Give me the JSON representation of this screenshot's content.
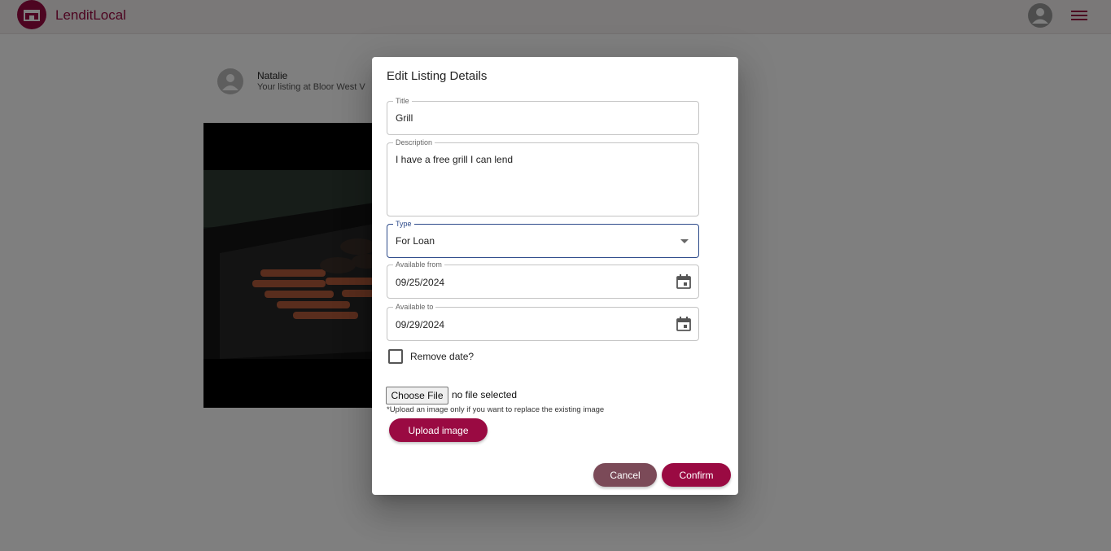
{
  "appbar": {
    "brand": "LenditLocal",
    "logo_icon": "storefront-icon",
    "avatar_icon": "account-circle-icon",
    "menu_icon": "hamburger-menu-icon",
    "accent_color": "#9a0a42"
  },
  "post": {
    "user_name": "Natalie",
    "subtitle": "Your listing at Bloor West V"
  },
  "dialog": {
    "title": "Edit Listing Details",
    "fields": {
      "title": {
        "label": "Title",
        "value": "Grill"
      },
      "description": {
        "label": "Description",
        "value": "I have a free grill I can lend"
      },
      "type": {
        "label": "Type",
        "value": "For Loan"
      },
      "available_from": {
        "label": "Available from",
        "value": "09/25/2024"
      },
      "available_to": {
        "label": "Available to",
        "value": "09/29/2024"
      }
    },
    "remove_date_label": "Remove date?",
    "file": {
      "button_label": "Choose File",
      "status": "no file selected",
      "hint": "*Upload an image only if you want to replace the existing image"
    },
    "upload_label": "Upload image",
    "cancel_label": "Cancel",
    "confirm_label": "Confirm"
  },
  "colors": {
    "primary": "#9a0a42",
    "cancel": "#7b4a58",
    "focus_border": "#2d4a8a"
  }
}
